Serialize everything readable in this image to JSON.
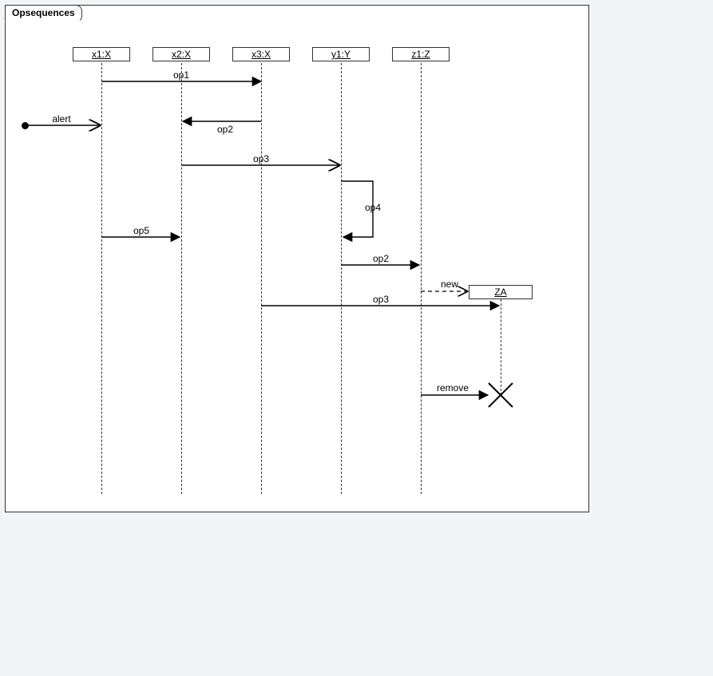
{
  "frame_title": "Opsequences",
  "lifelines": {
    "x1": "x1:X",
    "x2": "x2:X",
    "x3": "x3:X",
    "y1": "y1:Y",
    "z1": "z1:Z",
    "za": "ZA"
  },
  "messages": {
    "alert": "alert",
    "op1": "op1",
    "op2a": "op2",
    "op3a": "op3",
    "op4": "op4",
    "op5": "op5",
    "op2b": "op2",
    "new": "new",
    "op3b": "op3",
    "remove": "remove"
  },
  "chart_data": {
    "type": "sequence-diagram",
    "title": "Opsequences",
    "participants": [
      {
        "id": "x1",
        "label": "x1:X"
      },
      {
        "id": "x2",
        "label": "x2:X"
      },
      {
        "id": "x3",
        "label": "x3:X"
      },
      {
        "id": "y1",
        "label": "y1:Y"
      },
      {
        "id": "z1",
        "label": "z1:Z"
      },
      {
        "id": "za",
        "label": "ZA",
        "created": true,
        "destroyed": true
      }
    ],
    "messages": [
      {
        "from": "x1",
        "to": "x3",
        "label": "op1",
        "kind": "sync"
      },
      {
        "from": "gate",
        "to": "x1",
        "label": "alert",
        "kind": "async"
      },
      {
        "from": "x3",
        "to": "x2",
        "label": "op2",
        "kind": "sync"
      },
      {
        "from": "x2",
        "to": "y1",
        "label": "op3",
        "kind": "async"
      },
      {
        "from": "y1",
        "to": "y1",
        "label": "op4",
        "kind": "sync-self"
      },
      {
        "from": "x1",
        "to": "x2",
        "label": "op5",
        "kind": "sync"
      },
      {
        "from": "y1",
        "to": "z1",
        "label": "op2",
        "kind": "sync"
      },
      {
        "from": "z1",
        "to": "za",
        "label": "new",
        "kind": "create"
      },
      {
        "from": "x3",
        "to": "za",
        "label": "op3",
        "kind": "sync"
      },
      {
        "from": "z1",
        "to": "za",
        "label": "remove",
        "kind": "destroy"
      }
    ]
  }
}
